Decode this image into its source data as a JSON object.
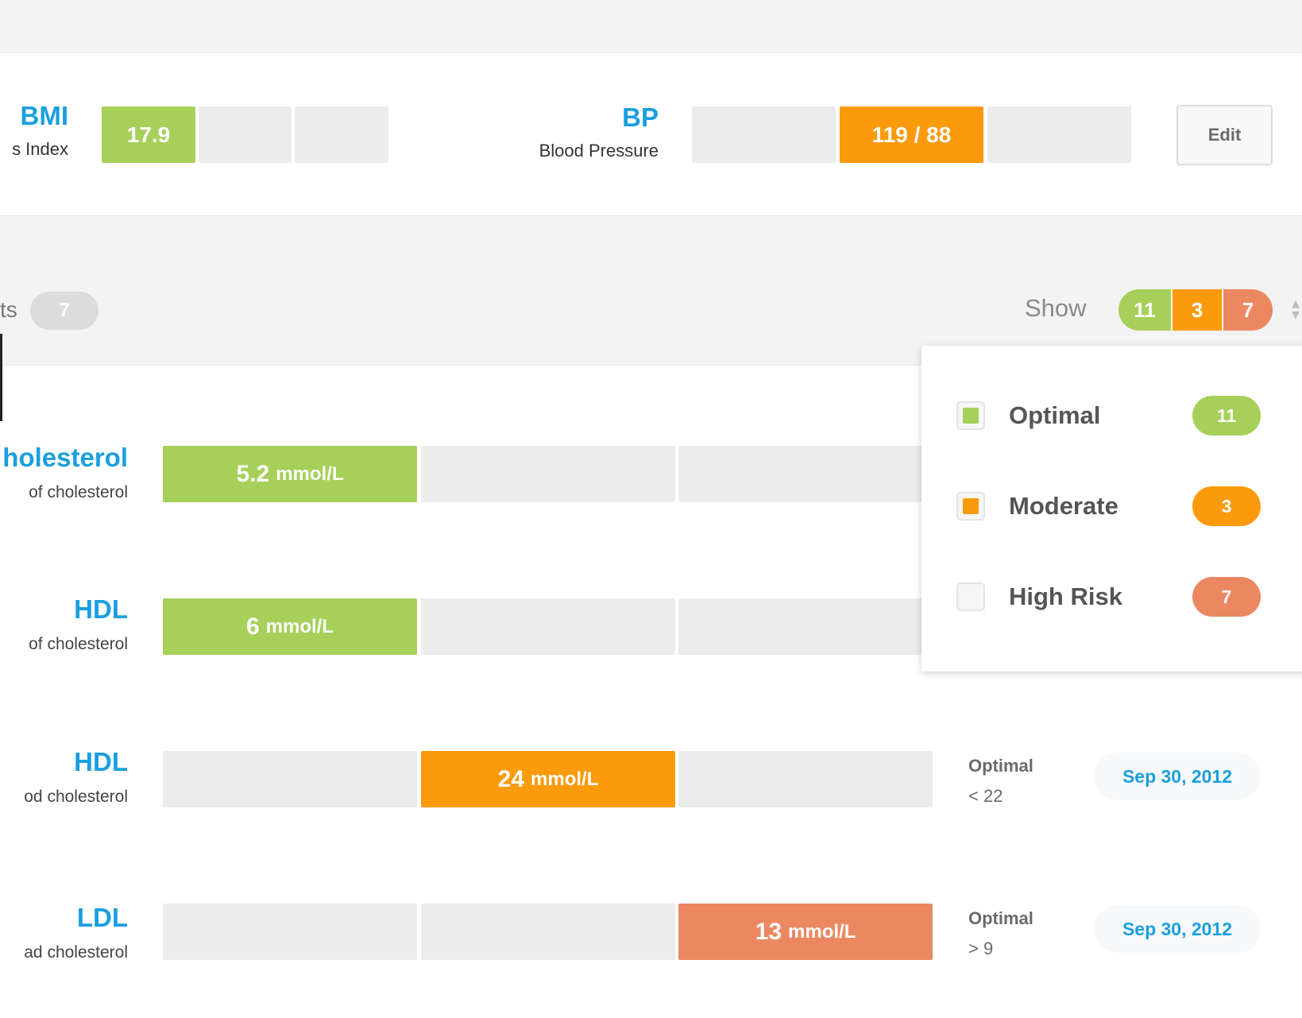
{
  "vitals": {
    "bmi": {
      "code": "BMI",
      "label": "s Index",
      "value": "17.9"
    },
    "bp": {
      "code": "BP",
      "label": "Blood Pressure",
      "value": "119 / 88"
    },
    "edit_label": "Edit"
  },
  "filter": {
    "left_label": "ts",
    "left_count": "7",
    "show_label": "Show",
    "counts": {
      "optimal": "11",
      "moderate": "3",
      "high_risk": "7"
    }
  },
  "dropdown": {
    "items": [
      {
        "label": "Optimal",
        "count": "11"
      },
      {
        "label": "Moderate",
        "count": "3"
      },
      {
        "label": "High Risk",
        "count": "7"
      }
    ]
  },
  "results": [
    {
      "code": "holesterol",
      "sub": "of cholesterol",
      "value": "5.2",
      "unit": "mmol/L",
      "level": "optimal"
    },
    {
      "code": "HDL",
      "sub": "of cholesterol",
      "value": "6",
      "unit": "mmol/L",
      "level": "optimal"
    },
    {
      "code": "HDL",
      "sub": "od cholesterol",
      "value": "24",
      "unit": "mmol/L",
      "level": "moderate",
      "optimal_label": "Optimal",
      "optimal_range": "< 22",
      "date": "Sep 30, 2012"
    },
    {
      "code": "LDL",
      "sub": "ad cholesterol",
      "value": "13",
      "unit": "mmol/L",
      "level": "high_risk",
      "optimal_label": "Optimal",
      "optimal_range": "> 9",
      "date": "Sep 30, 2012"
    }
  ],
  "colors": {
    "optimal": "#a6d05a",
    "moderate": "#fb9a0a",
    "high_risk": "#ec8861",
    "accent_blue": "#1a9fdf",
    "empty_segment": "#ececec"
  },
  "icons": {
    "sorter": "sort-arrows-icon"
  }
}
